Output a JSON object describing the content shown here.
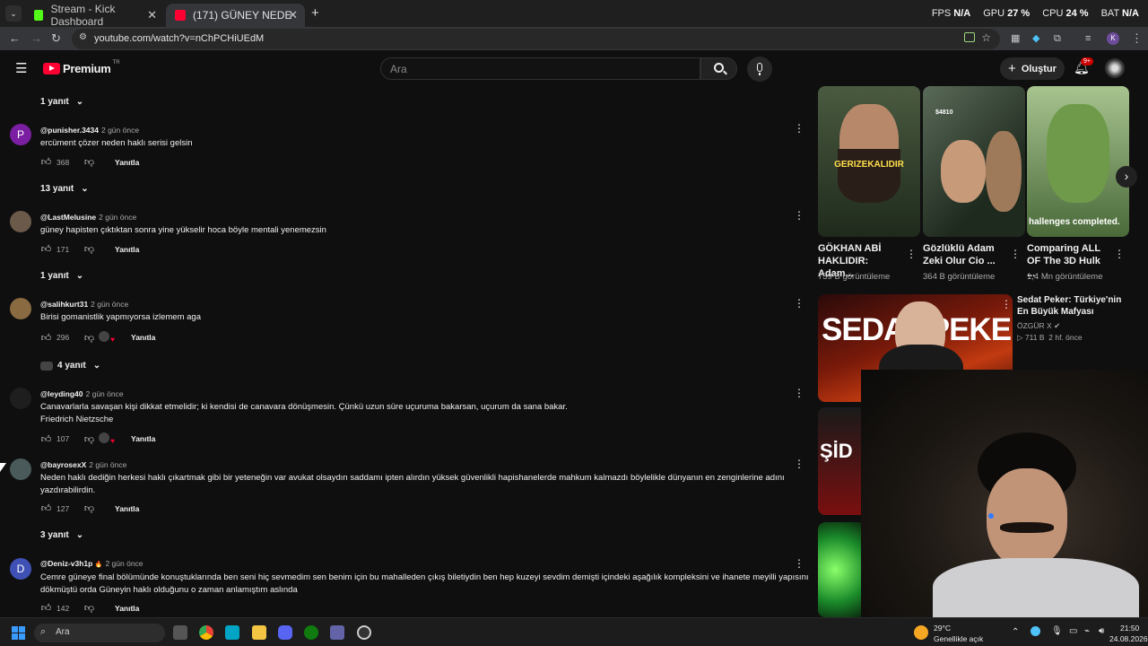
{
  "browser": {
    "tabs": [
      {
        "label": "Stream - Kick Dashboard",
        "favicon_color": "#53fc18"
      },
      {
        "label": "(171) GÜNEY NEDEN HAKLI? Ki",
        "favicon_color": "#ff0033"
      }
    ],
    "new_tab": "+",
    "stats": {
      "fps_label": "FPS",
      "fps": "N/A",
      "gpu_label": "GPU",
      "gpu": "27 %",
      "cpu_label": "CPU",
      "cpu": "24 %",
      "bat_label": "BAT",
      "bat": "N/A"
    },
    "url": "youtube.com/watch?v=nChPCHiUEdM",
    "profile_letter": "K"
  },
  "youtube": {
    "logo_text": "Premium",
    "logo_region": "TR",
    "search_placeholder": "Ara",
    "create_label": "Oluştur",
    "notif_badge": "9+"
  },
  "comments": {
    "reply_label": "Yanıtla",
    "items": [
      {
        "replies_above": "1 yanıt"
      },
      {
        "avatar_letter": "P",
        "avatar_color": "#7b1fa2",
        "author": "@punisher.3434",
        "time": "2 gün önce",
        "lines": [
          "ercüment çözer neden haklı serisi gelsin"
        ],
        "likes": "368",
        "replies": "13 yanıt"
      },
      {
        "avatar_letter": "",
        "avatar_color": "#6b5a4a",
        "author": "@LastMelusine",
        "time": "2 gün önce",
        "lines": [
          "güney hapisten çıktıktan sonra yine yükselir hoca böyle mentali yenemezsin"
        ],
        "likes": "171",
        "replies": "1 yanıt"
      },
      {
        "avatar_letter": "",
        "avatar_color": "#8a6a40",
        "author": "@salihkurt31",
        "time": "2 gün önce",
        "lines": [
          "Birisi gomanistlik yapmıyorsa izlemem aga"
        ],
        "likes": "296",
        "replies": "4 yanıt",
        "hearted": true
      },
      {
        "avatar_letter": "",
        "avatar_color": "#202020",
        "author": "@leyding40",
        "time": "2 gün önce",
        "lines": [
          "Canavarlarla savaşan kişi dikkat etmelidir; ki kendisi de canavara dönüşmesin. Çünkü uzun süre uçuruma bakarsan, uçurum da sana bakar.",
          "Friedrich Nietzsche"
        ],
        "likes": "107",
        "hearted": true
      },
      {
        "avatar_letter": "",
        "avatar_color": "#4a5a5a",
        "author": "@bayrosexX",
        "time": "2 gün önce",
        "lines": [
          "Neden haklı dediğin herkesi haklı çıkartmak gibi bir yeteneğin var avukat olsaydın saddamı ipten alırdın yüksek güvenlikli hapishanelerde mahkum kalmazdı böylelikle dünyanın en zenginlerine adını",
          "yazdırabilirdin."
        ],
        "likes": "127",
        "replies": "3 yanıt"
      },
      {
        "avatar_letter": "D",
        "avatar_color": "#3f51b5",
        "author": "@Deniz-v3h1p",
        "badge": "🔥",
        "time": "2 gün önce",
        "lines": [
          "Cemre güneye final bölümünde konuştuklarında ben seni hiç sevmedim sen benim için bu mahalleden çıkış biletiydin ben hep kuzeyi sevdim demişti içindeki aşağılık kompleksini ve ihanete meyilli yapısını",
          "dökmüştü orda Güneyin haklı olduğunu o zaman anlamıştım aslında"
        ],
        "likes": "142"
      }
    ]
  },
  "sidebar": {
    "shorts": [
      {
        "title": "GÖKHAN ABİ HAKLIDIR: Adam...",
        "views": "759 B görüntüleme",
        "overlay": "GERIZEKALIDIR",
        "bg": "#3a4a35"
      },
      {
        "title": "Gözlüklü Adam Zeki Olur Cio ...",
        "views": "364 B görüntüleme",
        "overlay": "$4810",
        "bg": "#2f3a2a"
      },
      {
        "title": "Comparing ALL OF The 3D Hulk ...",
        "views": "1,4 Mn görüntüleme",
        "overlay": "hallenges completed.",
        "bg": "#6a8a5a"
      }
    ],
    "video": {
      "thumb_text": "SEDAT PEKER",
      "title": "Sedat Peker: Türkiye'nin En Büyük Mafyası",
      "channel": "ÖZGÜR X",
      "views": "711 B",
      "age": "2 hf. önce"
    },
    "partial_thumb_text": "ŞİD"
  },
  "taskbar": {
    "search_placeholder": "Ara",
    "weather_temp": "29°C",
    "weather_desc": "Genellikle açık",
    "time": "21:50",
    "date": "24.08.2026"
  }
}
